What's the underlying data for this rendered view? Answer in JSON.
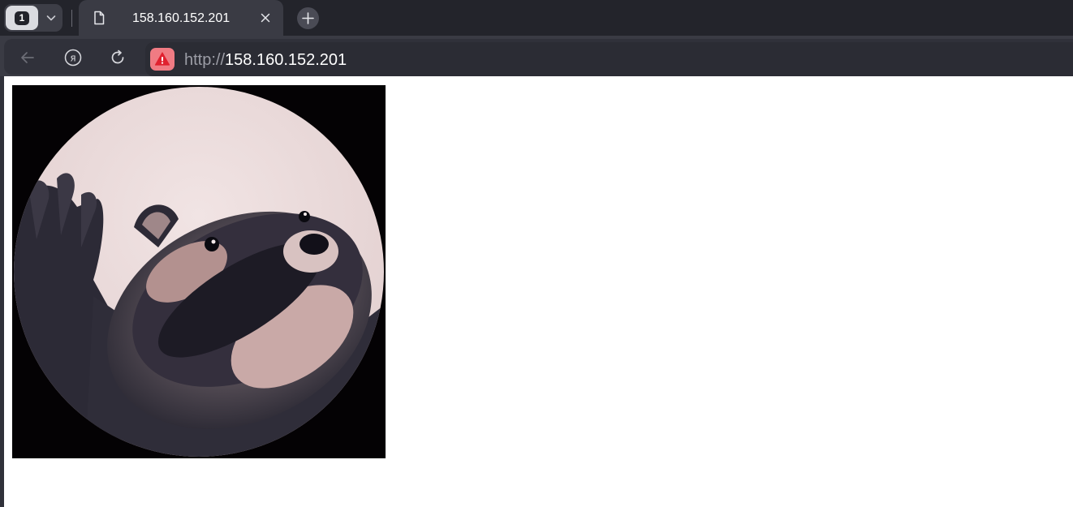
{
  "tabstrip": {
    "tab_count": "1",
    "tabs": [
      {
        "title": "158.160.152.201",
        "active": true
      }
    ]
  },
  "toolbar": {
    "icons": {
      "back": "back-arrow-icon",
      "yandex": "yandex-logo-icon",
      "reload": "reload-icon",
      "security": "warning-icon"
    }
  },
  "address_bar": {
    "scheme": "http://",
    "host": "158.160.152.201"
  },
  "page": {
    "image": {
      "subject": "raccoon-image"
    }
  },
  "colors": {
    "tabstrip_bg": "#23242b",
    "toolbar_bg": "#3a3b44",
    "omnibox_bg": "#2b2c34",
    "security_warning": "#f07b83",
    "page_bg": "#ffffff"
  }
}
